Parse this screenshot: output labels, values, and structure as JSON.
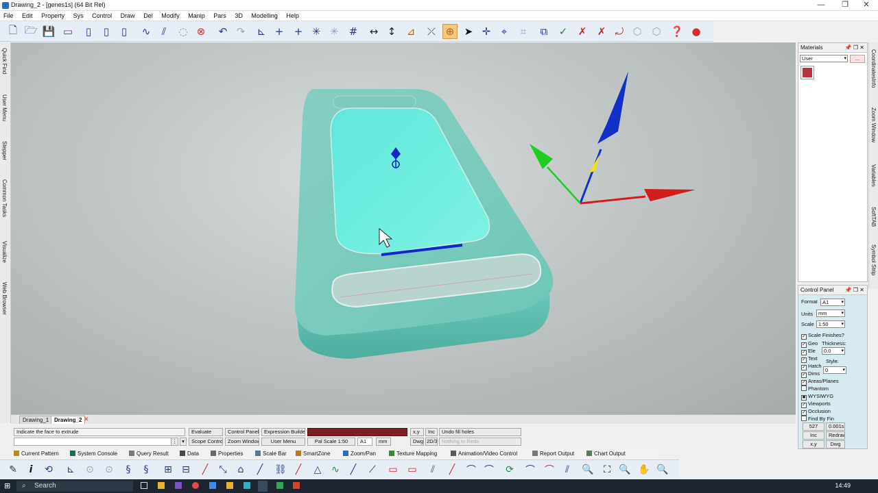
{
  "window": {
    "title": "Drawing_2 - [genes1s] (64 Bit Rel)",
    "min": "—",
    "restore": "❐",
    "close": "✕"
  },
  "menu": [
    "File",
    "Edit",
    "Property",
    "Sys",
    "Control",
    "Draw",
    "Del",
    "Modify",
    "Manip",
    "Pars",
    "3D",
    "Modelling",
    "Help"
  ],
  "left_tabs": [
    "Quick Find",
    "User Menu",
    "Stepper",
    "Common Tasks",
    "Visualize",
    "Web Browser"
  ],
  "right_tabs": [
    "CoordinatesInfo",
    "Zoom Window",
    "Variables",
    "SoftTAB",
    "Symbol Strip"
  ],
  "doc_tabs": [
    "Drawing_1",
    "Drawing_2"
  ],
  "status": {
    "prompt": "Indicate the face to extrude",
    "evaluate": "Evaluate",
    "control_panel": "Control Panel",
    "expression_builder": "Expression Builder",
    "xy": "x,y",
    "inc": "Inc",
    "undo": "Undo fill holes",
    "scope_control": "Scope Control",
    "zoom_window": "Zoom Window",
    "user_menu": "User Menu",
    "pal_scale": "Pal Scale 1:50",
    "sheet": "A1",
    "units": "mm",
    "dwg": "Dwg",
    "mode": "2D/3D",
    "redo": "Nothing to Redo"
  },
  "bottom_bar": [
    {
      "label": "Current Pattern",
      "color": "#b58a1e"
    },
    {
      "label": "System Console",
      "color": "#1a6e4a"
    },
    {
      "label": "Query Result",
      "color": "#7a7a7a"
    },
    {
      "label": "Data",
      "color": "#4a4a4a"
    },
    {
      "label": "Properties",
      "color": "#6a6a6a"
    },
    {
      "label": "Scale Bar",
      "color": "#5a7a9a"
    },
    {
      "label": "SmartZone",
      "color": "#b57a1e"
    },
    {
      "label": "Zoom/Pan",
      "color": "#2a6ebb"
    },
    {
      "label": "Texture Mapping",
      "color": "#3a8a3a"
    },
    {
      "label": "Animation/Video Control",
      "color": "#5a5a5a"
    },
    {
      "label": "Report Output",
      "color": "#7a7a7a"
    },
    {
      "label": "Chart Output",
      "color": "#5a7a5a"
    }
  ],
  "materials": {
    "title": "Materials",
    "dropdown": "User",
    "more": "...",
    "swatch_color": "#b8323f"
  },
  "control_panel": {
    "title": "Control Panel",
    "format_label": "Format",
    "format_value": "A1",
    "units_label": "Units",
    "units_value": "mm",
    "scale_label": "Scale",
    "scale_value": "1:50",
    "scale_finishes": "Scale Finishes?",
    "thickness_label": "Thickness:",
    "thickness_value": "0.0",
    "style_label": "Style:",
    "style_value": "0",
    "geo": "Geo",
    "ele": "Ele",
    "text": "Text",
    "hatch": "Hatch",
    "dims": "Dims",
    "areas_planes": "Areas/Planes",
    "phantom": "Phantom",
    "wysiwyg": "WYSIWYG",
    "viewports": "Viewports",
    "occlusion": "Occlusion",
    "find_by_fin": "Find By Fin",
    "count": "527",
    "time": "0.001s",
    "inc": "Inc",
    "redraw": "Redraw",
    "xy": "x,y",
    "dwg": "Dwg"
  },
  "taskbar": {
    "search_placeholder": "Search",
    "time": "14:49"
  },
  "colors": {
    "model": "#7fe3d3",
    "axis_x": "#d41c1c",
    "axis_y": "#1fcc1f",
    "axis_z": "#1030c8",
    "toolbar_bg": "#e8eef5"
  }
}
